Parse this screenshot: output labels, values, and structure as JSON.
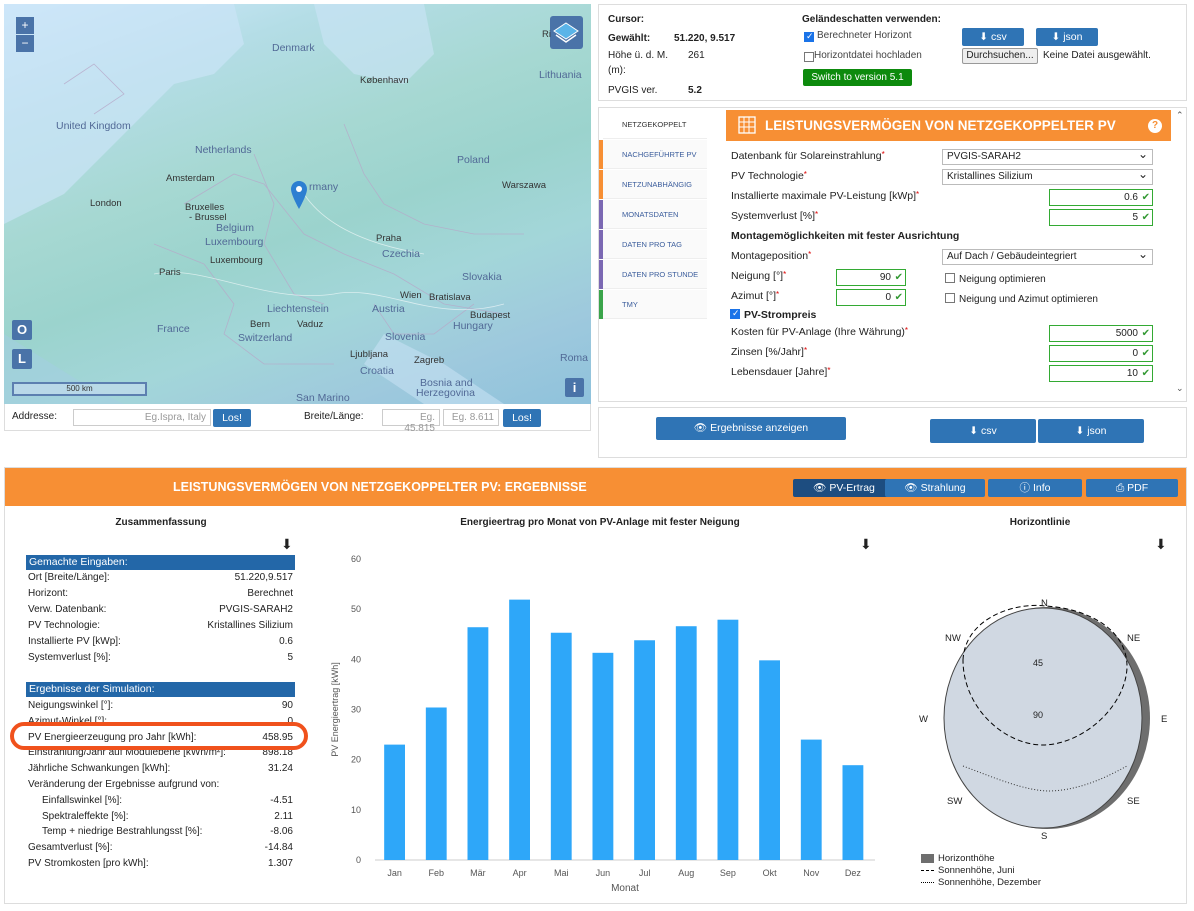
{
  "map": {
    "zoom_in": "+",
    "zoom_out": "−",
    "scale": "500 km",
    "btn_o": "O",
    "btn_l": "L",
    "btn_i": "i",
    "layer_label": "Ri",
    "labels": {
      "uk": "United Kingdom",
      "netherlands": "Netherlands",
      "amsterdam": "Amsterdam",
      "london": "London",
      "bruxelles": "Bruxelles",
      "brussel": "- Brussel",
      "belgium": "Belgium",
      "luxembourg_c": "Luxembourg",
      "luxembourg": "Luxembourg",
      "paris": "Paris",
      "france": "France",
      "denmark": "Denmark",
      "kobenhavn": "København",
      "lithuania": "Lithuania",
      "poland": "Poland",
      "warszawa": "Warszawa",
      "germany": "rmany",
      "praha": "Praha",
      "czechia": "Czechia",
      "slovakia": "Slovakia",
      "wien": "Wien",
      "bratislava": "Bratislava",
      "austria": "Austria",
      "budapest": "Budapest",
      "hungary": "Hungary",
      "liechtenstein": "Liechtenstein",
      "bern": "Bern",
      "vaduz": "Vaduz",
      "switzerland": "Switzerland",
      "slovenia": "Slovenia",
      "ljubljana": "Ljubljana",
      "zagreb": "Zagreb",
      "croatia": "Croatia",
      "bosnia1": "Bosnia and",
      "bosnia2": "Herzegovina",
      "sanmarino": "San Marino",
      "roma": "Roma"
    }
  },
  "address": {
    "label": "Addresse:",
    "placeholder": "Eg.Ispra, Italy",
    "go": "Los!",
    "latlon_label": "Breite/Länge:",
    "lat_placeholder": "Eg. 45.815",
    "lon_placeholder": "Eg. 8.611",
    "go2": "Los!"
  },
  "info": {
    "cursor_label": "Cursor:",
    "selected_label": "Gewählt:",
    "selected_value": "51.220, 9.517",
    "height_label": "Höhe ü. d. M.",
    "height_unit": "(m):",
    "height_value": "261",
    "pvgis_label": "PVGIS ver.",
    "pvgis_value": "5.2",
    "terrain_label": "Geländeschatten verwenden:",
    "calc_horizon": "Berechneter Horizont",
    "upload_horizon": "Horizontdatei hochladen",
    "switch_version": "Switch to version 5.1",
    "csv": "csv",
    "json": "json",
    "browse": "Durchsuchen...",
    "no_file": "Keine Datei ausgewählt."
  },
  "tabs": [
    {
      "label": "NETZGEKOPPELT",
      "color": "#ffffff"
    },
    {
      "label": "NACHGEFÜHRTE PV",
      "color": "#f78f34"
    },
    {
      "label": "NETZUNABHÄNGIG",
      "color": "#f78f34"
    },
    {
      "label": "MONATSDATEN",
      "color": "#7b68b3"
    },
    {
      "label": "DATEN PRO TAG",
      "color": "#7b68b3"
    },
    {
      "label": "DATEN PRO STUNDE",
      "color": "#7b68b3"
    },
    {
      "label": "TMY",
      "color": "#3aa44a"
    }
  ],
  "form": {
    "title": "LEISTUNGSVERMÖGEN VON NETZGEKOPPELTER PV",
    "help": "?",
    "db_label": "Datenbank für Solareinstrahlung",
    "db_value": "PVGIS-SARAH2",
    "tech_label": "PV Technologie",
    "tech_value": "Kristallines Silizium",
    "power_label": "Installierte maximale PV-Leistung [kWp]",
    "power_value": "0.6",
    "loss_label": "Systemverlust [%]",
    "loss_value": "5",
    "mount_heading": "Montagemöglichkeiten mit fester Ausrichtung",
    "mount_label": "Montageposition",
    "mount_value": "Auf Dach / Gebäudeintegriert",
    "slope_label": "Neigung [°]",
    "slope_value": "90",
    "slope_opt": "Neigung optimieren",
    "azimuth_label": "Azimut [°]",
    "azimuth_value": "0",
    "both_opt": "Neigung und Azimut optimieren",
    "price_heading": "PV-Strompreis",
    "cost_label": "Kosten für PV-Anlage (Ihre Währung)",
    "cost_value": "5000",
    "interest_label": "Zinsen [%/Jahr]",
    "interest_value": "0",
    "life_label": "Lebensdauer [Jahre]",
    "life_value": "10"
  },
  "actions": {
    "show_results": "Ergebnisse anzeigen",
    "csv": "csv",
    "json": "json"
  },
  "results": {
    "title": "LEISTUNGSVERMÖGEN VON NETZGEKOPPELTER PV: ERGEBNISSE",
    "btn_yield": "PV-Ertrag",
    "btn_radiation": "Strahlung",
    "btn_info": "Info",
    "btn_pdf": "PDF",
    "summary_title": "Zusammenfassung",
    "chart_title": "Energieertrag pro Monat von PV-Anlage mit fester Neigung",
    "horizon_title": "Horizontlinie",
    "inputs_heading": "Gemachte Eingaben:",
    "inputs": [
      {
        "label": "Ort [Breite/Länge]:",
        "value": "51.220,9.517"
      },
      {
        "label": "Horizont:",
        "value": "Berechnet"
      },
      {
        "label": "Verw. Datenbank:",
        "value": "PVGIS-SARAH2"
      },
      {
        "label": "PV Technologie:",
        "value": "Kristallines Silizium"
      },
      {
        "label": "Installierte PV [kWp]:",
        "value": "0.6"
      },
      {
        "label": "Systemverlust [%]:",
        "value": "5"
      }
    ],
    "sim_heading": "Ergebnisse der Simulation:",
    "sim": [
      {
        "label": "Neigungswinkel [°]:",
        "value": "90"
      },
      {
        "label": "Azimut-Winkel [°]:",
        "value": "0"
      },
      {
        "label": "PV Energieerzeugung pro Jahr [kWh]:",
        "value": "458.95"
      },
      {
        "label": "Einstrahlung/Jahr auf Modulebene [kWh/m²]:",
        "value": "898.18"
      },
      {
        "label": "Jährliche Schwankungen [kWh]:",
        "value": "31.24"
      },
      {
        "label": "Veränderung der Ergebnisse aufgrund von:",
        "value": ""
      },
      {
        "label": "Einfallswinkel [%]:",
        "value": "-4.51"
      },
      {
        "label": "Spektraleffekte [%]:",
        "value": "2.11"
      },
      {
        "label": "Temp + niedrige Bestrahlungsst [%]:",
        "value": "-8.06"
      },
      {
        "label": "Gesamtverlust [%]:",
        "value": "-14.84"
      },
      {
        "label": "PV Stromkosten [pro kWh]:",
        "value": "1.307"
      }
    ],
    "horizon": {
      "n": "N",
      "ne": "NE",
      "e": "E",
      "se": "SE",
      "s": "S",
      "sw": "SW",
      "w": "W",
      "nw": "NW",
      "r45": "45",
      "r90": "90",
      "legend_height": "Horizonthöhe",
      "legend_june": "Sonnenhöhe, Juni",
      "legend_dec": "Sonnenhöhe, Dezember"
    }
  },
  "chart_data": {
    "type": "bar",
    "title": "Energieertrag pro Monat von PV-Anlage mit fester Neigung",
    "xlabel": "Monat",
    "ylabel": "PV Energieertrag [kWh]",
    "categories": [
      "Jan",
      "Feb",
      "Mär",
      "Apr",
      "Mai",
      "Jun",
      "Jul",
      "Aug",
      "Sep",
      "Okt",
      "Nov",
      "Dez"
    ],
    "values": [
      23.0,
      30.4,
      46.4,
      51.9,
      45.3,
      41.3,
      43.8,
      46.6,
      47.9,
      39.8,
      24.0,
      18.9
    ],
    "ylim": [
      0,
      60
    ],
    "yticks": [
      0,
      10,
      20,
      30,
      40,
      50,
      60
    ],
    "color": "#2ea7f9",
    "grid": false
  }
}
